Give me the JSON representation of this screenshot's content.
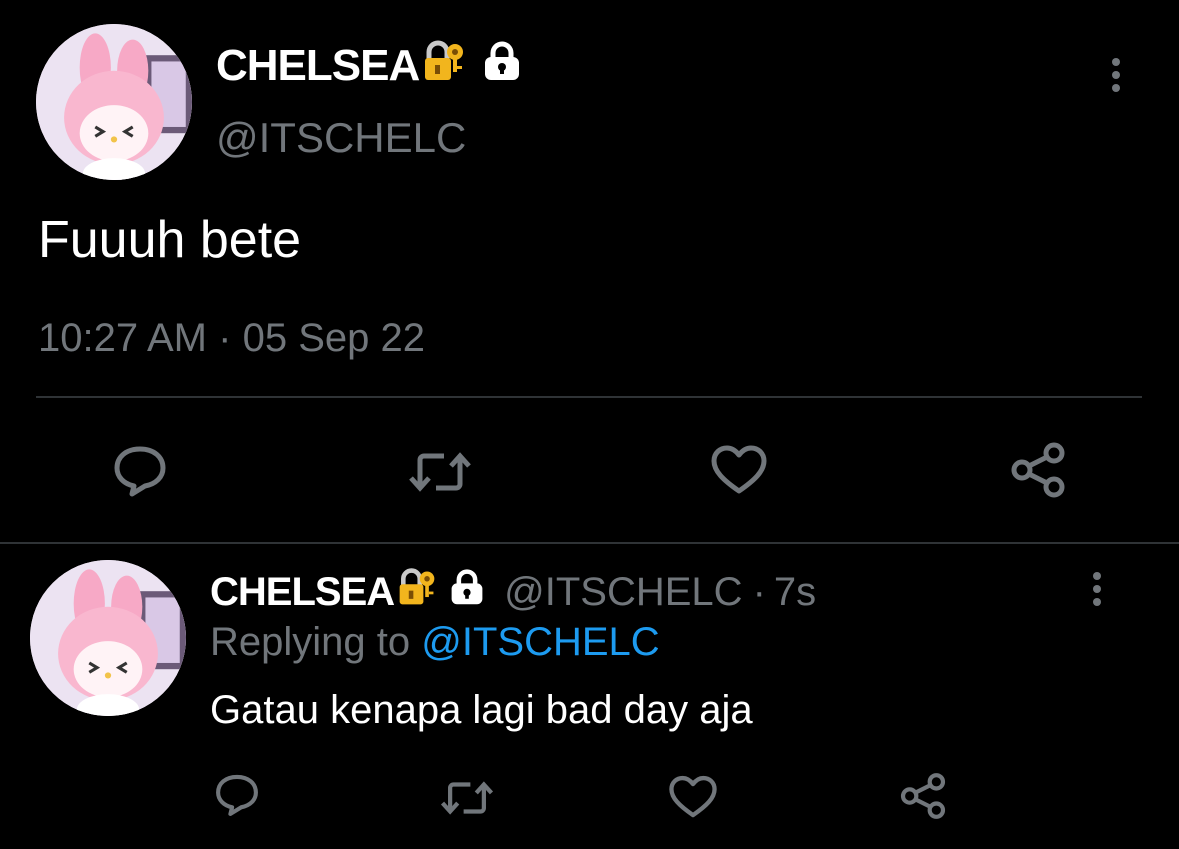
{
  "main_tweet": {
    "display_name": "CHELSEA",
    "handle": "@ITSCHELC",
    "text": "Fuuuh bete",
    "time": "10:27 AM",
    "separator": "·",
    "date": "05 Sep 22",
    "badge_icons": [
      "locked-with-key-emoji",
      "lock-icon"
    ],
    "actions": [
      "reply-icon",
      "retweet-icon",
      "like-icon",
      "share-icon"
    ]
  },
  "reply_tweet": {
    "display_name": "CHELSEA",
    "handle": "@ITSCHELC",
    "separator": "·",
    "age": "7s",
    "replying_prefix": "Replying to",
    "replying_handle": "@ITSCHELC",
    "text": "Gatau kenapa lagi bad day aja",
    "badge_icons": [
      "locked-with-key-emoji",
      "lock-icon"
    ],
    "actions": [
      "reply-icon",
      "retweet-icon",
      "like-icon",
      "share-icon"
    ]
  },
  "colors": {
    "background": "#000000",
    "text": "#ffffff",
    "muted": "#71767b",
    "link": "#1d9bf0",
    "divider": "#2f3336"
  }
}
